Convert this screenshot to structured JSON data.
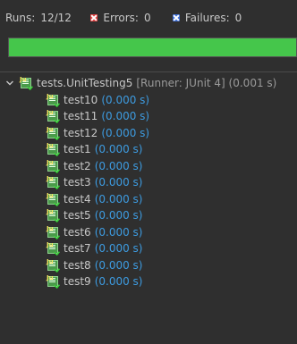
{
  "summary": {
    "runs_label": "Runs:",
    "runs_value": "12/12",
    "errors_label": "Errors:",
    "errors_value": "0",
    "failures_label": "Failures:",
    "failures_value": "0"
  },
  "progress": {
    "fraction": 1.0,
    "color": "#45c64b"
  },
  "suite": {
    "name": "tests.UnitTesting5",
    "detail": "[Runner: JUnit 4] (0.001 s)",
    "icon": "junit-suite-icon",
    "expanded": true
  },
  "tests": [
    {
      "name": "test10",
      "time": "(0.000 s)"
    },
    {
      "name": "test11",
      "time": "(0.000 s)"
    },
    {
      "name": "test12",
      "time": "(0.000 s)"
    },
    {
      "name": "test1",
      "time": "(0.000 s)"
    },
    {
      "name": "test2",
      "time": "(0.000 s)"
    },
    {
      "name": "test3",
      "time": "(0.000 s)"
    },
    {
      "name": "test4",
      "time": "(0.000 s)"
    },
    {
      "name": "test5",
      "time": "(0.000 s)"
    },
    {
      "name": "test6",
      "time": "(0.000 s)"
    },
    {
      "name": "test7",
      "time": "(0.000 s)"
    },
    {
      "name": "test8",
      "time": "(0.000 s)"
    },
    {
      "name": "test9",
      "time": "(0.000 s)"
    }
  ],
  "colors": {
    "background": "#2f2f2f",
    "time_text": "#3d9be0",
    "error_icon": "#e04040",
    "failure_icon": "#3f6fd6"
  }
}
